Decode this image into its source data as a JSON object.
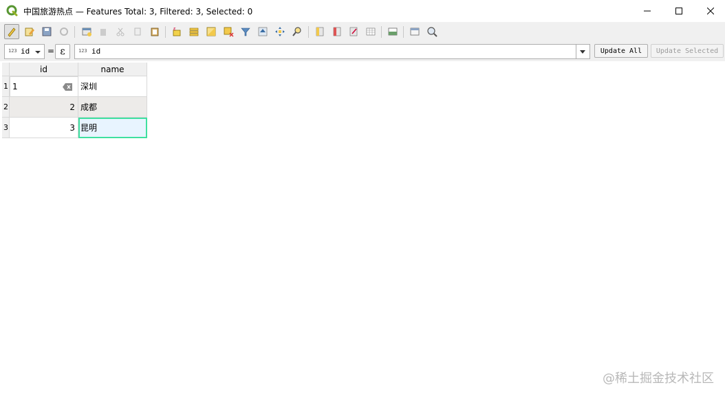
{
  "window": {
    "title": "中国旅游热点 — Features Total: 3, Filtered: 3, Selected: 0",
    "minimize": "—",
    "maximize": "☐",
    "close": "✕"
  },
  "toolbar": {
    "icons": [
      "toggle-editing-icon",
      "multi-edit-icon",
      "save-edits-icon",
      "reload-table-icon",
      "add-feature-icon",
      "delete-feature-icon",
      "cut-icon",
      "copy-icon",
      "paste-icon",
      "select-by-expression-icon",
      "select-all-icon",
      "invert-selection-icon",
      "deselect-all-icon",
      "filter-select-icon",
      "move-selection-top-icon",
      "pan-to-selected-icon",
      "zoom-to-selected-icon",
      "new-field-icon",
      "delete-field-icon",
      "field-calculator-icon",
      "conditional-formatting-icon",
      "dock-table-icon",
      "actions-icon",
      "zoom-map-to-rows-icon"
    ]
  },
  "expression_bar": {
    "field_type": "123",
    "field_name": "id",
    "equals": "=",
    "epsilon": "ε",
    "expr_type": "123",
    "expression": "id",
    "update_all": "Update All",
    "update_selected": "Update Selected"
  },
  "table": {
    "columns": [
      "id",
      "name"
    ],
    "rows": [
      {
        "row_header": "1",
        "id": "1",
        "name": "深圳"
      },
      {
        "row_header": "2",
        "id": "2",
        "name": "成都"
      },
      {
        "row_header": "3",
        "id": "3",
        "name": "昆明"
      }
    ]
  },
  "watermark": "@稀土掘金技术社区",
  "colors": {
    "selection_outline": "#3fe0a0",
    "header_bg": "#f0f0f0",
    "alt_row": "#edebe9"
  }
}
